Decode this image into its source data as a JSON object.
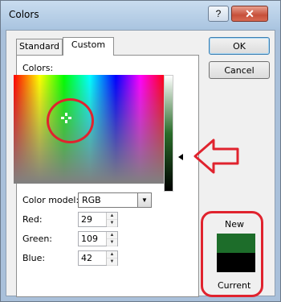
{
  "window": {
    "title": "Colors"
  },
  "titlebar": {
    "help_label": "?",
    "close_label": "✕"
  },
  "tabs": [
    {
      "label": "Standard"
    },
    {
      "label": "Custom"
    }
  ],
  "custom": {
    "colors_label": "Colors:",
    "color_model_label": "Color model:",
    "color_model_value": "RGB",
    "red_label": "Red:",
    "red_value": "29",
    "green_label": "Green:",
    "green_value": "109",
    "blue_label": "Blue:",
    "blue_value": "42"
  },
  "buttons": {
    "ok": "OK",
    "cancel": "Cancel"
  },
  "preview": {
    "new_label": "New",
    "current_label": "Current",
    "new_color": "#1d6d2a",
    "current_color": "#000000"
  },
  "colors": {
    "annotation": "#e0232e"
  }
}
